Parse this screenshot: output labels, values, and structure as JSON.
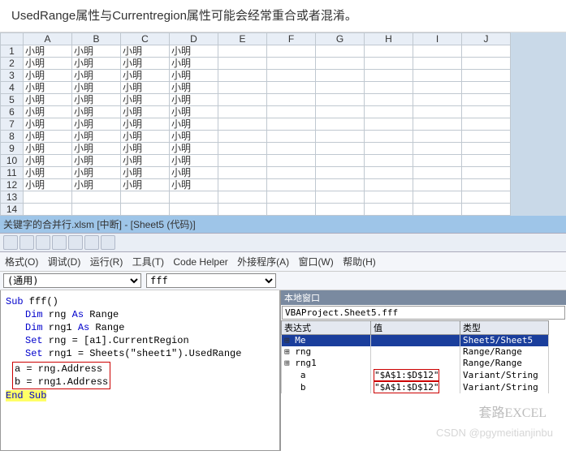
{
  "description": "UsedRange属性与Currentregion属性可能会经常重合或者混淆。",
  "spreadsheet": {
    "columns": [
      "A",
      "B",
      "C",
      "D",
      "E",
      "F",
      "G",
      "H",
      "I",
      "J"
    ],
    "rows": [
      1,
      2,
      3,
      4,
      5,
      6,
      7,
      8,
      9,
      10,
      11,
      12,
      13,
      14
    ],
    "filled_rows": 12,
    "filled_cols": 4,
    "cell_value": "小明"
  },
  "titlebar": "关键字的合并行.xlsm [中断] - [Sheet5 (代码)]",
  "menu": {
    "format": "格式(O)",
    "debug": "调试(D)",
    "run": "运行(R)",
    "tools": "工具(T)",
    "codehelper": "Code Helper",
    "addins": "外接程序(A)",
    "window": "窗口(W)",
    "help": "帮助(H)"
  },
  "dropdown_left": "(通用)",
  "dropdown_right": "fff",
  "code": {
    "l1a": "Sub",
    "l1b": " fff()",
    "l2a": "Dim",
    "l2b": " rng ",
    "l2c": "As",
    "l2d": " Range",
    "l3a": "Dim",
    "l3b": " rng1 ",
    "l3c": "As",
    "l3d": " Range",
    "l4a": "Set",
    "l4b": " rng = [a1].CurrentRegion",
    "l5a": "Set",
    "l5b": " rng1 = Sheets(\"sheet1\").UsedRange",
    "l6": "a = rng.Address",
    "l7": "b = rng1.Address",
    "l8": "End Sub"
  },
  "locals": {
    "title": "本地窗口",
    "path": "VBAProject.Sheet5.fff",
    "headers": {
      "expr": "表达式",
      "val": "值",
      "type": "类型"
    },
    "rows": [
      {
        "exp": "⊞",
        "name": "Me",
        "val": "",
        "type": "Sheet5/Sheet5",
        "sel": true
      },
      {
        "exp": "⊞",
        "name": "rng",
        "val": "",
        "type": "Range/Range"
      },
      {
        "exp": "⊞",
        "name": "rng1",
        "val": "",
        "type": "Range/Range"
      },
      {
        "exp": "",
        "name": "a",
        "val": "\"$A$1:$D$12\"",
        "type": "Variant/String",
        "box": true
      },
      {
        "exp": "",
        "name": "b",
        "val": "\"$A$1:$D$12\"",
        "type": "Variant/String",
        "box": true
      }
    ]
  },
  "watermark1": "套路EXCEL",
  "watermark2": "CSDN @pgymeitianjinbu"
}
